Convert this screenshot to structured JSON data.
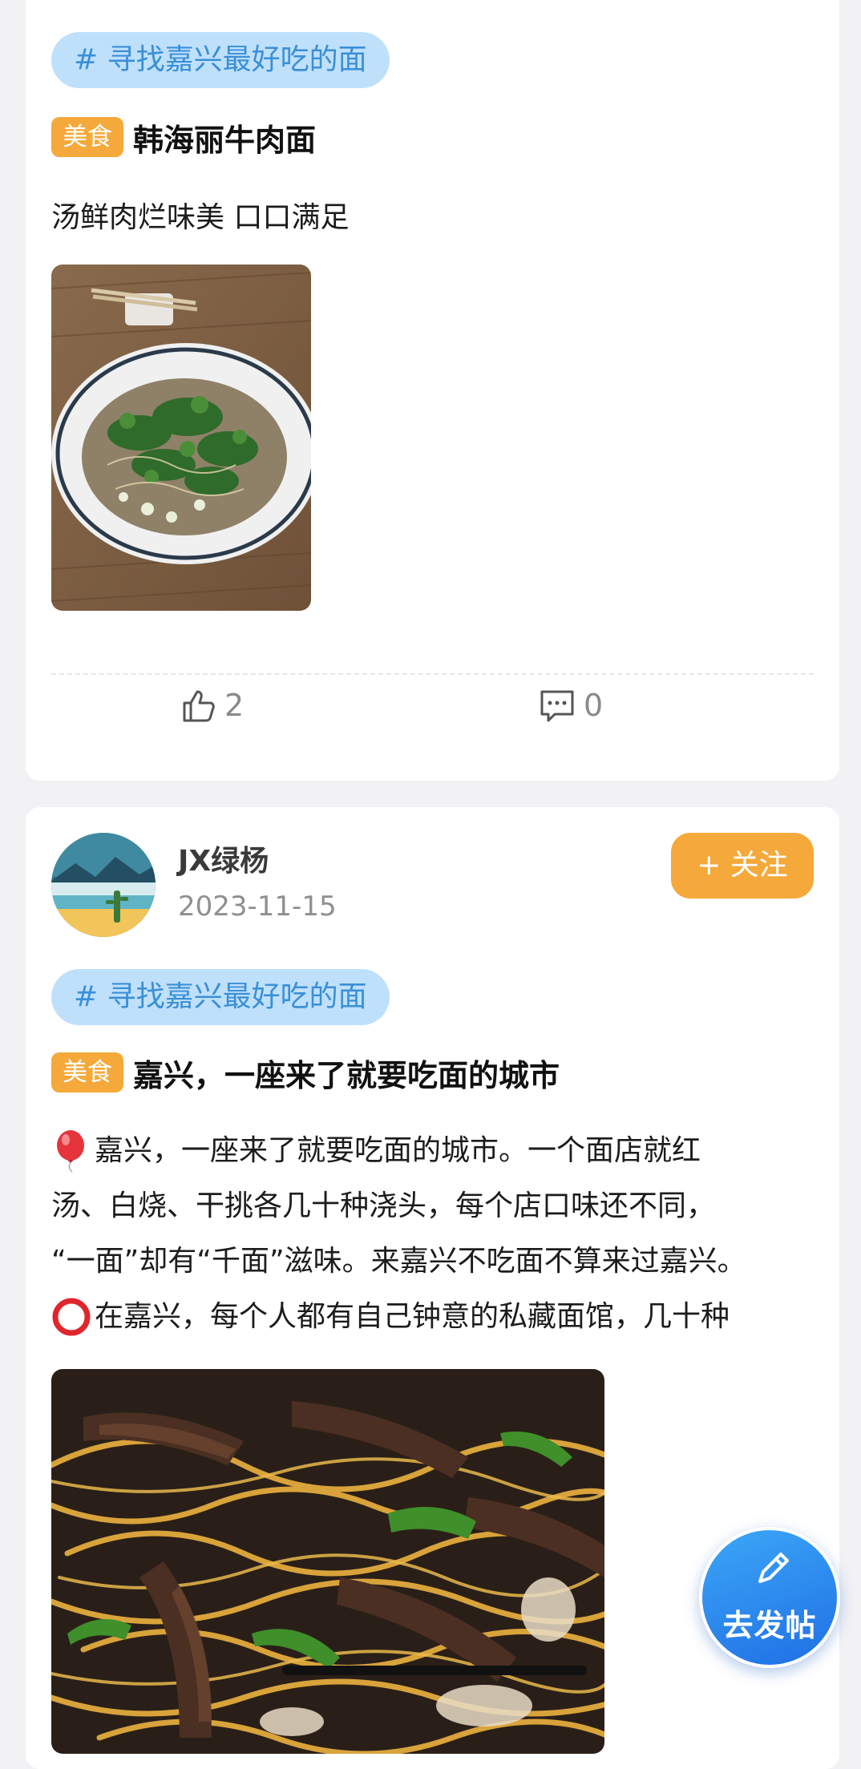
{
  "post1": {
    "topic": "# 寻找嘉兴最好吃的面",
    "tag": "美食",
    "title": "韩海丽牛肉面",
    "description": "汤鲜肉烂味美 口口满足",
    "likes": "2",
    "comments": "0"
  },
  "post2": {
    "author": "JX绿杨",
    "date": "2023-11-15",
    "follow_label": "+ 关注",
    "topic": "# 寻找嘉兴最好吃的面",
    "tag": "美食",
    "title": "嘉兴，一座来了就要吃面的城市",
    "body_lines": [
      "嘉兴，一座来了就要吃面的城市。一个面店就红",
      "汤、白烧、干挑各几十种浇头，每个店口味还不同，",
      "“一面”却有“千面”滋味。来嘉兴不吃面不算来过嘉兴。",
      "在嘉兴，每个人都有自己钟意的私藏面馆，几十种"
    ]
  },
  "fab": {
    "label": "去发帖",
    "icon": "pencil-icon"
  },
  "colors": {
    "tag_orange": "#f5a93a",
    "topic_chip_bg": "#bfe0fb",
    "topic_chip_text": "#3a8fd8",
    "fab_blue": "#2a86ee"
  }
}
